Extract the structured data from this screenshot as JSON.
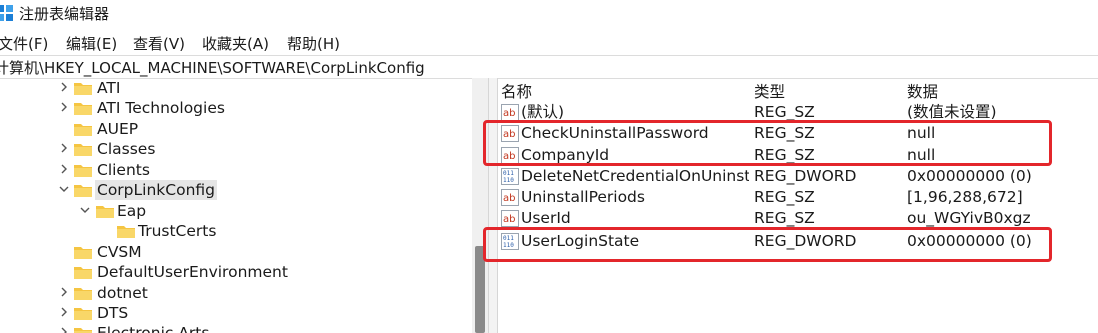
{
  "window": {
    "title": "注册表编辑器"
  },
  "menu": [
    "文件(F)",
    "编辑(E)",
    "查看(V)",
    "收藏夹(A)",
    "帮助(H)"
  ],
  "address": "计算机\\HKEY_LOCAL_MACHINE\\SOFTWARE\\CorpLinkConfig",
  "tree": [
    {
      "label": "ATI",
      "expander": "collapsed",
      "selected": false
    },
    {
      "label": "ATI Technologies",
      "expander": "collapsed",
      "selected": false
    },
    {
      "label": "AUEP",
      "expander": "none",
      "selected": false
    },
    {
      "label": "Classes",
      "expander": "collapsed",
      "selected": false
    },
    {
      "label": "Clients",
      "expander": "collapsed",
      "selected": false
    },
    {
      "label": "CorpLinkConfig",
      "expander": "expanded",
      "selected": true
    },
    {
      "label": "Eap",
      "expander": "expanded",
      "selected": false
    },
    {
      "label": "TrustCerts",
      "expander": "none",
      "selected": false
    },
    {
      "label": "CVSM",
      "expander": "none",
      "selected": false
    },
    {
      "label": "DefaultUserEnvironment",
      "expander": "none",
      "selected": false
    },
    {
      "label": "dotnet",
      "expander": "collapsed",
      "selected": false
    },
    {
      "label": "DTS",
      "expander": "collapsed",
      "selected": false
    },
    {
      "label": "Electronic Arts",
      "expander": "collapsed",
      "selected": false
    }
  ],
  "columns": {
    "name": "名称",
    "type": "类型",
    "data": "数据"
  },
  "values": [
    {
      "icon": "string-value-icon",
      "name": "(默认)",
      "type": "REG_SZ",
      "data": "(数值未设置)"
    },
    {
      "icon": "string-value-icon",
      "name": "CheckUninstallPassword",
      "type": "REG_SZ",
      "data": "null"
    },
    {
      "icon": "string-value-icon",
      "name": "CompanyId",
      "type": "REG_SZ",
      "data": "null"
    },
    {
      "icon": "dword-value-icon",
      "name": "DeleteNetCredentialOnUninst...",
      "type": "REG_DWORD",
      "data": "0x00000000 (0)"
    },
    {
      "icon": "string-value-icon",
      "name": "UninstallPeriods",
      "type": "REG_SZ",
      "data": "[1,96,288,672]"
    },
    {
      "icon": "string-value-icon",
      "name": "UserId",
      "type": "REG_SZ",
      "data": "ou_WGYivB0xgz"
    },
    {
      "icon": "dword-value-icon",
      "name": "UserLoginState",
      "type": "REG_DWORD",
      "data": "0x00000000 (0)"
    }
  ],
  "colors": {
    "annotation": "#e3262b",
    "folder": "#f5c542",
    "selection": "#e5e5e5"
  }
}
